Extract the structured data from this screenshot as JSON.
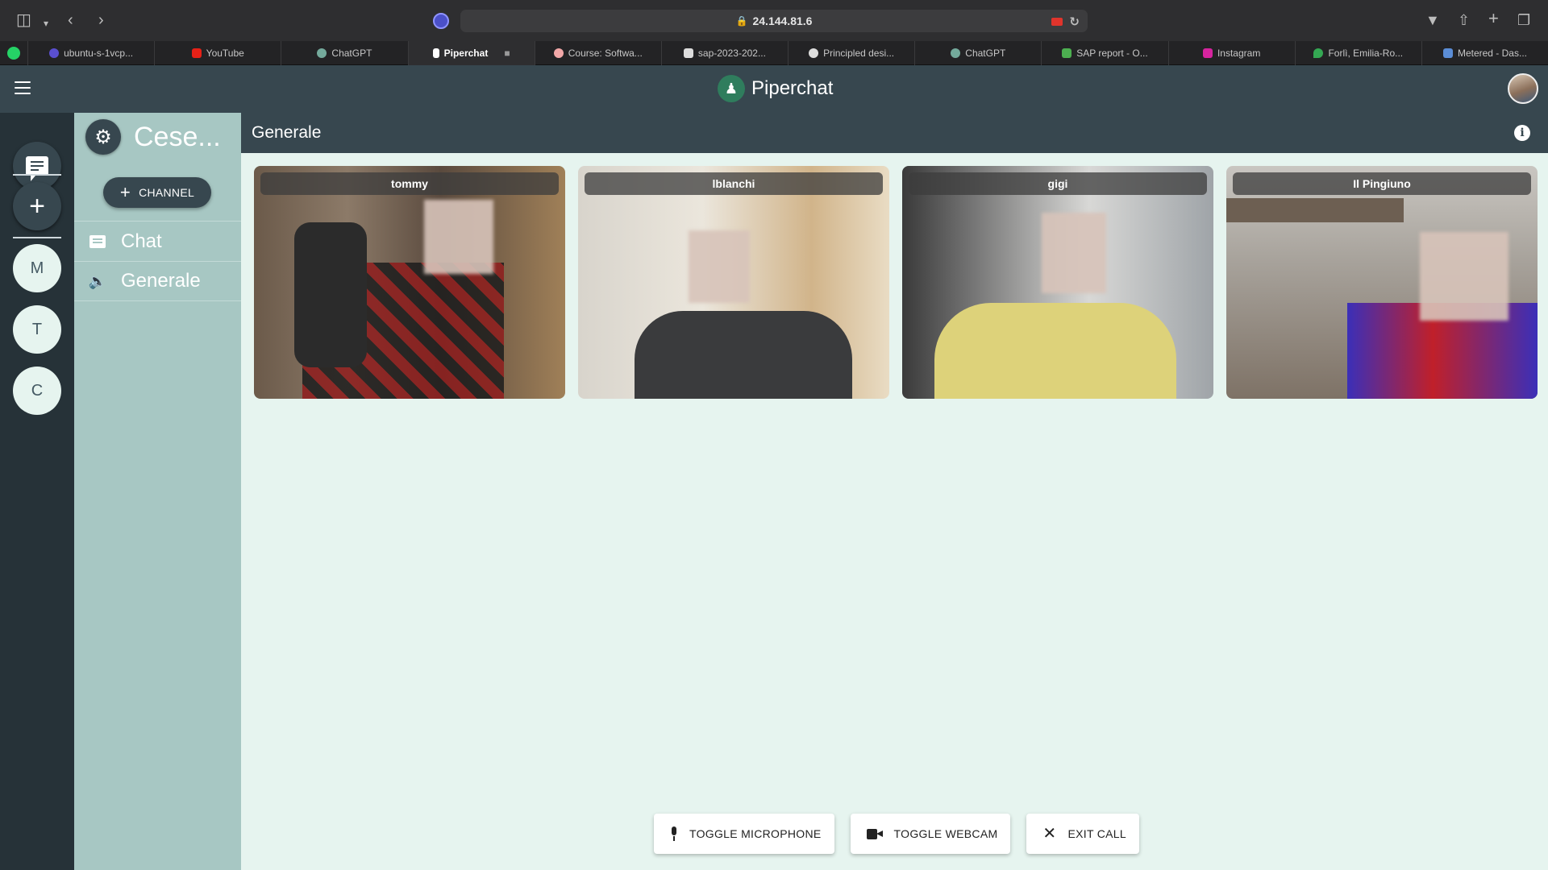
{
  "browser": {
    "address": "24.144.81.6",
    "tabs": [
      {
        "label": "ubuntu-s-1vcp...",
        "color": "#5a4fcf"
      },
      {
        "label": "YouTube",
        "color": "#e62117"
      },
      {
        "label": "ChatGPT",
        "color": "#74aa9c"
      },
      {
        "label": "Piperchat",
        "color": "#ffffff",
        "active": true
      },
      {
        "label": "Course: Softwa...",
        "color": "#f2a8a8"
      },
      {
        "label": "sap-2023-202...",
        "color": "#dddddd"
      },
      {
        "label": "Principled desi...",
        "color": "#dddddd"
      },
      {
        "label": "ChatGPT",
        "color": "#74aa9c"
      },
      {
        "label": "SAP report - O...",
        "color": "#4caf50"
      },
      {
        "label": "Instagram",
        "color": "#d6249f"
      },
      {
        "label": "Forlì, Emilia-Ro...",
        "color": "#34a853"
      },
      {
        "label": "Metered - Das...",
        "color": "#5b8dd6"
      }
    ]
  },
  "app": {
    "brand": "Piperchat"
  },
  "rail": {
    "servers": [
      "M",
      "T",
      "C"
    ]
  },
  "sidebar": {
    "server_name": "Cese...",
    "add_channel_label": "CHANNEL",
    "channels": [
      {
        "label": "Chat",
        "kind": "text"
      },
      {
        "label": "Generale",
        "kind": "voice"
      }
    ]
  },
  "main": {
    "title": "Generale",
    "participants": [
      "tommy",
      "lblanchi",
      "gigi",
      "Il Pingiuno"
    ],
    "controls": {
      "mic": "TOGGLE MICROPHONE",
      "webcam": "TOGGLE WEBCAM",
      "exit": "EXIT CALL"
    }
  }
}
